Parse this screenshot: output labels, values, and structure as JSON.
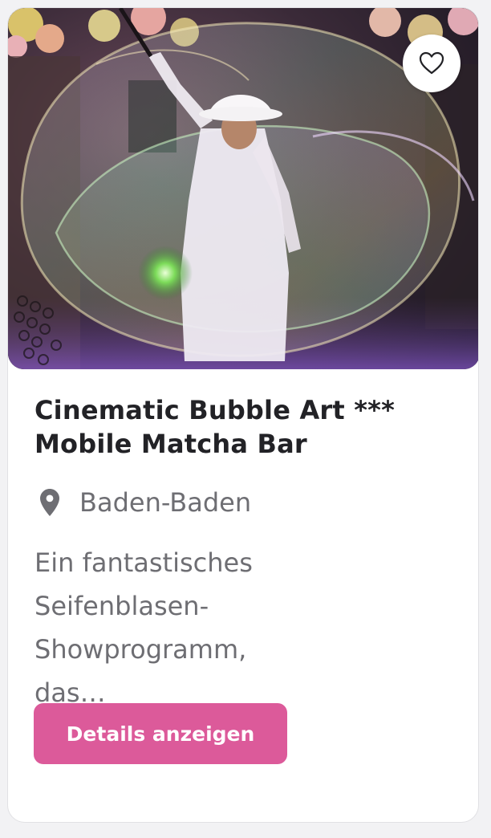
{
  "card": {
    "favorite_icon": "heart-outline-icon",
    "title": "Cinematic Bubble Art *** Mobile Matcha Bar",
    "location_icon": "map-pin-icon",
    "location": "Baden-Baden",
    "description": "Ein fantastisches Seifenblasen-Showprogramm, das…",
    "button_label": "Details anzeigen"
  },
  "colors": {
    "accent": "#dc5a9a",
    "title_text": "#222226",
    "secondary_text": "#6e6e73",
    "card_background": "#ffffff"
  }
}
